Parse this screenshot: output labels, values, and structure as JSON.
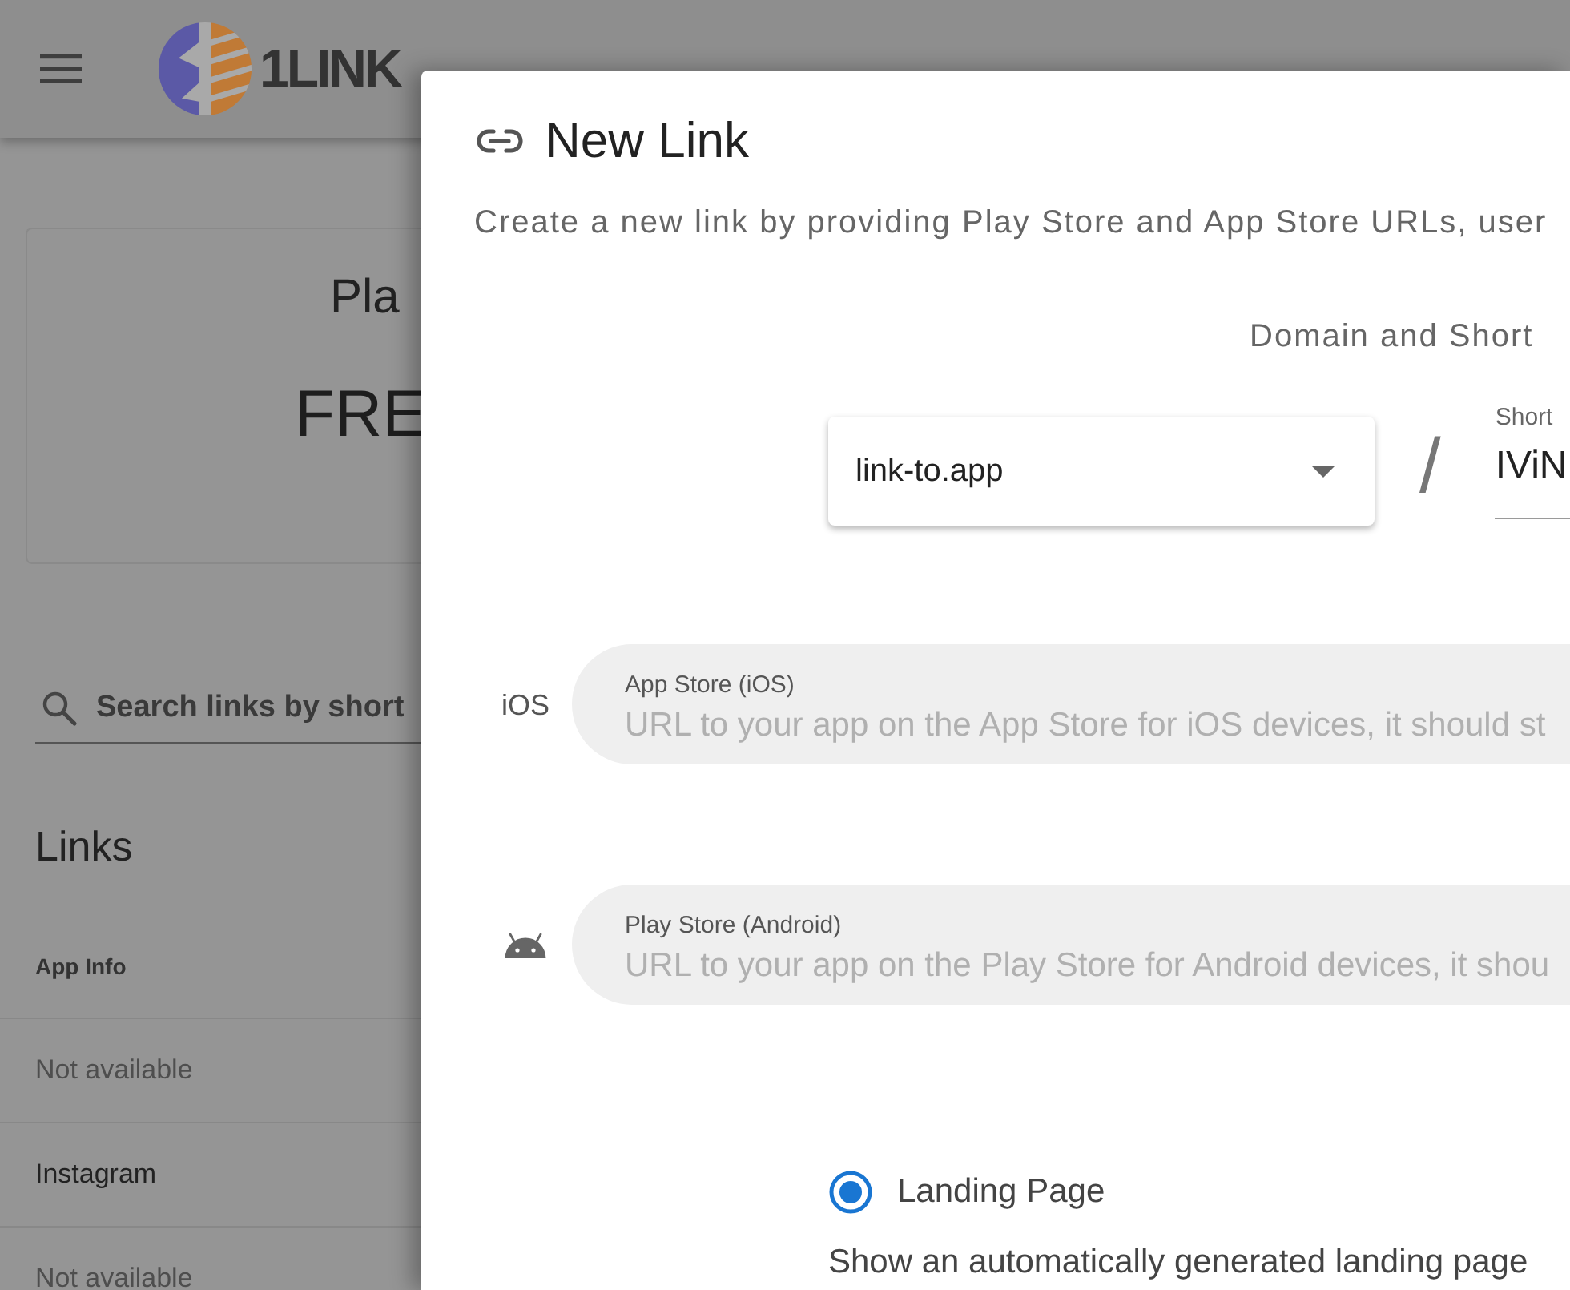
{
  "app_bar": {
    "logo_text": "1LINK"
  },
  "plan_card": {
    "label": "Pla",
    "value": "FRE"
  },
  "search": {
    "placeholder": "Search links by short"
  },
  "links": {
    "title": "Links",
    "columns": [
      "App Info"
    ],
    "rows": [
      {
        "app_info": "Not available",
        "available": false
      },
      {
        "app_info": "Instagram",
        "available": true
      },
      {
        "app_info": "Not available",
        "available": false
      }
    ]
  },
  "dialog": {
    "title": "New Link",
    "description": "Create a new link by providing Play Store and App Store URLs, user",
    "domain_heading": "Domain and Short",
    "domain_select": {
      "value": "link-to.app"
    },
    "separator": "/",
    "short_field": {
      "label": "Short",
      "value": "IViN"
    },
    "store_fields": [
      {
        "kind": "text",
        "platform": "iOS",
        "label": "App Store (iOS)",
        "placeholder": "URL to your app on the App Store for iOS devices, it should st"
      },
      {
        "kind": "icon",
        "label": "Play Store (Android)",
        "placeholder": "URL to your app on the Play Store for Android devices, it shou"
      }
    ],
    "link_types": [
      {
        "label": "Landing Page",
        "selected": true,
        "description": "Show an automatically generated landing page"
      }
    ]
  }
}
